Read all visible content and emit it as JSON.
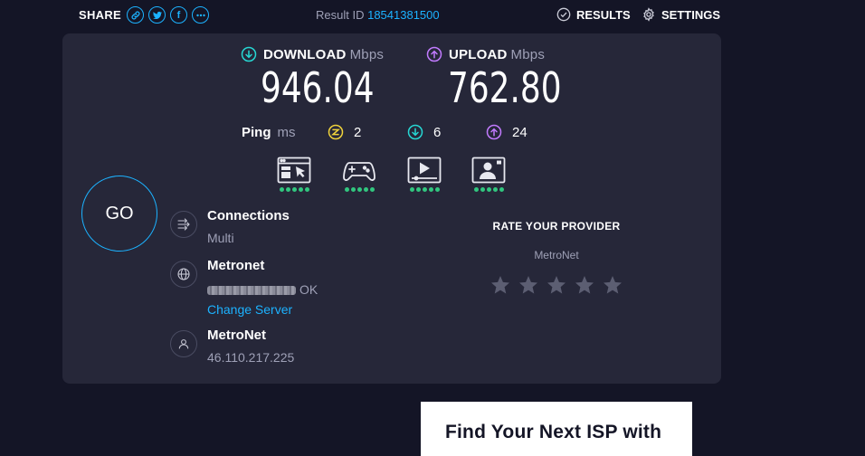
{
  "topbar": {
    "share_label": "SHARE",
    "share_buttons": [
      {
        "icon": "link-icon"
      },
      {
        "icon": "twitter-icon"
      },
      {
        "icon": "facebook-icon",
        "glyph": "f"
      },
      {
        "icon": "more-icon"
      }
    ],
    "result_label": "Result ID",
    "result_id": "18541381500",
    "results_label": "RESULTS",
    "settings_label": "SETTINGS"
  },
  "download": {
    "label": "DOWNLOAD",
    "unit": "Mbps",
    "value": "946.04",
    "color": "#26d8d4"
  },
  "upload": {
    "label": "UPLOAD",
    "unit": "Mbps",
    "value": "762.80",
    "color": "#c27bff"
  },
  "ping": {
    "label": "Ping",
    "unit": "ms",
    "idle": {
      "value": "2",
      "color": "#f0d33b",
      "icon": "idle-latency-icon"
    },
    "download": {
      "value": "6",
      "color": "#26d8d4",
      "icon": "download-latency-icon"
    },
    "upload": {
      "value": "24",
      "color": "#c27bff",
      "icon": "upload-latency-icon"
    }
  },
  "app_ratings": [
    {
      "icon": "web-browsing-icon",
      "rating": 5
    },
    {
      "icon": "gaming-icon",
      "rating": 5
    },
    {
      "icon": "video-streaming-icon",
      "rating": 5
    },
    {
      "icon": "video-chat-icon",
      "rating": 5
    }
  ],
  "go_label": "GO",
  "connections": {
    "title": "Connections",
    "value": "Multi"
  },
  "server": {
    "title": "Metronet",
    "status": "OK",
    "change_label": "Change Server"
  },
  "provider": {
    "title": "MetroNet",
    "ip": "46.110.217.225"
  },
  "rate": {
    "title": "RATE YOUR PROVIDER",
    "provider": "MetroNet",
    "stars": 0,
    "max_stars": 5
  },
  "promo": {
    "text": "Find Your Next ISP with"
  },
  "colors": {
    "accent": "#1cb2ff",
    "background": "#141526",
    "card": "#262739",
    "good": "#31c77f"
  }
}
